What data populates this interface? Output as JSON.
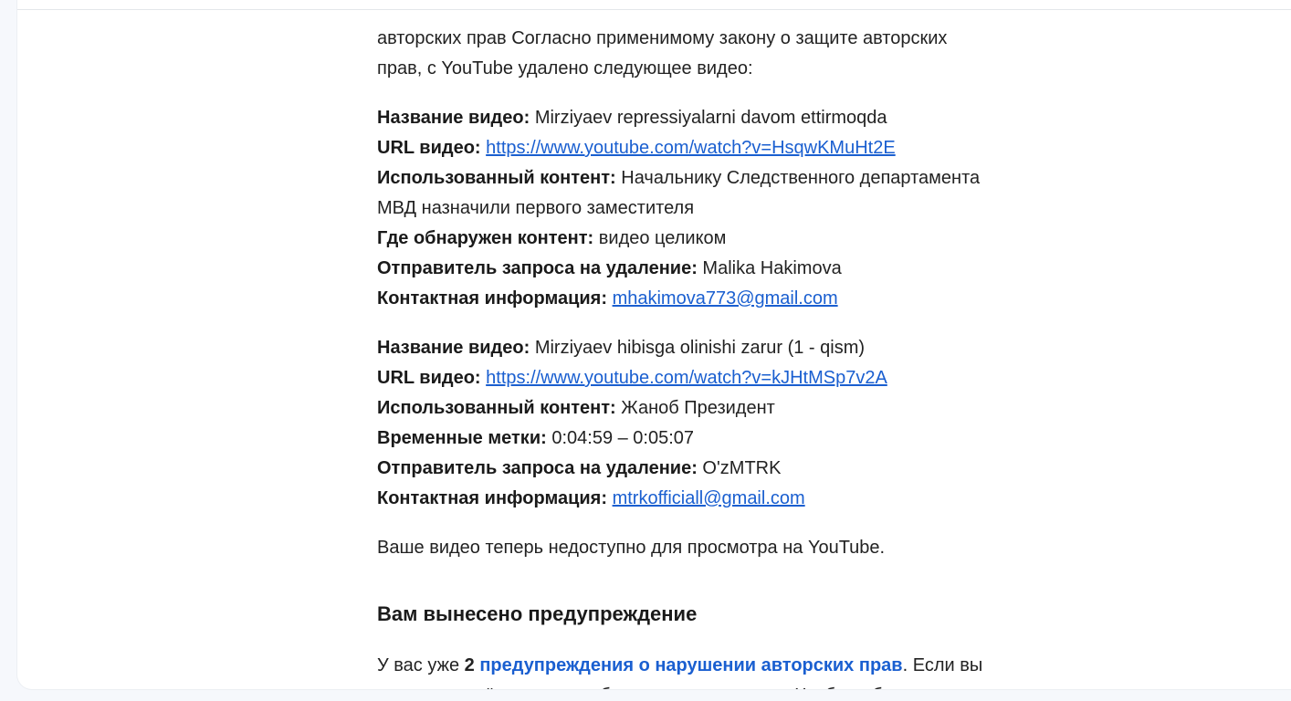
{
  "intro": {
    "line1": "авторских прав Согласно применимому закону о защите авторских",
    "line2": "прав, с YouTube удалено следующее видео:"
  },
  "videos": [
    {
      "title_label": "Название видео:",
      "title": "Mirziyaev repressiyalarni davom ettirmoqda",
      "url_label": "URL видео:",
      "url": "https://www.youtube.com/watch?v=HsqwKMuHt2E",
      "content_label": "Использованный контент:",
      "content_line1": "Начальнику Следственного департамента",
      "content_line2": "МВД назначили первого заместителя",
      "location_label": "Где обнаружен контент:",
      "location": "видео целиком",
      "sender_label": "Отправитель запроса на удаление:",
      "sender": "Malika Hakimova",
      "contact_label": "Контактная информация:",
      "contact": "mhakimova773@gmail.com"
    },
    {
      "title_label": "Название видео:",
      "title": "Mirziyaev hibisga olinishi zarur (1 - qism)",
      "url_label": "URL видео:",
      "url": "https://www.youtube.com/watch?v=kJHtMSp7v2A",
      "content_label": "Использованный контент:",
      "content": "Жаноб Президент",
      "timestamps_label": "Временные метки:",
      "timestamps": "0:04:59 – 0:05:07",
      "sender_label": "Отправитель запроса на удаление:",
      "sender": "O'zMTRK",
      "contact_label": "Контактная информация:",
      "contact": "mtrkofficiall@gmail.com"
    }
  ],
  "unavailable_note": "Ваше видео теперь недоступно для просмотра на YouTube.",
  "warning": {
    "heading": "Вам вынесено предупреждение",
    "text_prefix": "У вас уже",
    "count": "2",
    "link": "предупреждения о нарушении авторских прав",
    "text_suffix": ". Если вы",
    "line2": "получите ещё одно, мы заблокируем ваш канал. Чтобы избежать этого,"
  }
}
